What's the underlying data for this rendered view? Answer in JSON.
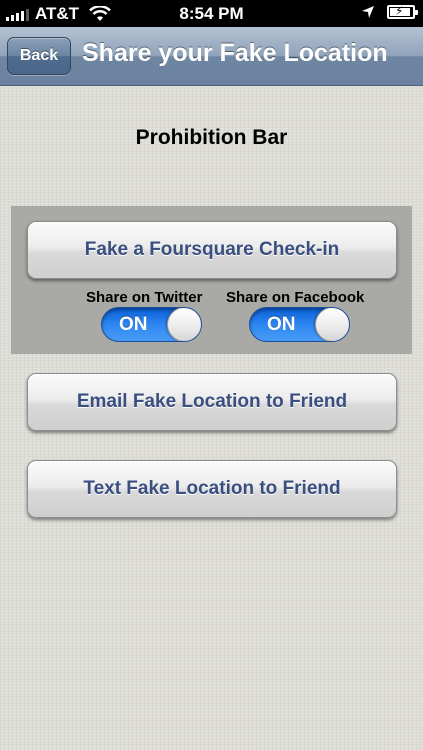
{
  "status_bar": {
    "carrier": "AT&T",
    "time": "8:54 PM",
    "signal_bars": 4,
    "battery_charging": true
  },
  "nav": {
    "back_label": "Back",
    "title": "Share your Fake Location"
  },
  "place": {
    "name": "Prohibition Bar"
  },
  "checkin": {
    "button_label": "Fake a Foursquare Check-in",
    "twitter": {
      "label": "Share on Twitter",
      "state": "ON"
    },
    "facebook": {
      "label": "Share on Facebook",
      "state": "ON"
    }
  },
  "actions": {
    "email_label": "Email Fake Location to Friend",
    "text_label": "Text Fake Location to Friend"
  },
  "colors": {
    "nav_bar": "#6e86a2",
    "button_text": "#3a4f80",
    "switch_on": "#2d86f0",
    "panel": "#a9a9a5"
  }
}
